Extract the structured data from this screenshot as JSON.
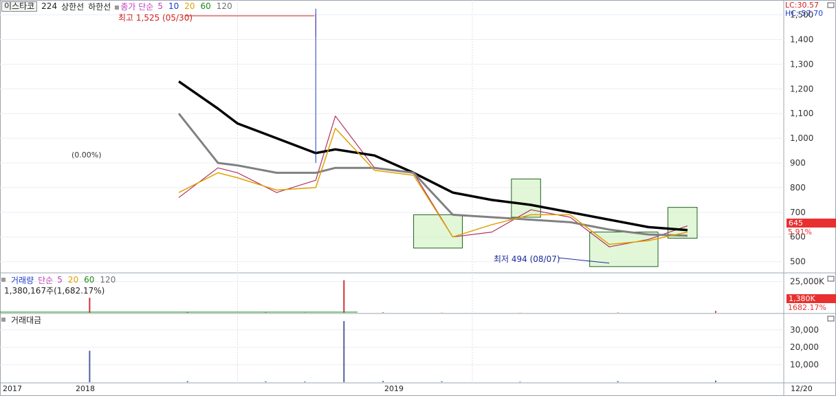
{
  "header": {
    "market": "이스타코",
    "ticker": "224",
    "upper_limit_label": "상한선",
    "lower_limit_label": "하한선",
    "price_type": "종가 단순",
    "ma_periods": [
      "5",
      "10",
      "20",
      "60",
      "120"
    ],
    "ma_colors": [
      "#c040c0",
      "#1a3ad0",
      "#e0a000",
      "#1a8a1a",
      "#707070"
    ]
  },
  "price_readouts": {
    "lc": "LC:30.57",
    "hc": "HC:-57.70",
    "last_price": "645",
    "last_change": "5.91%"
  },
  "annotations": {
    "high": "최고 1,525 (05/30)",
    "low": "최저 494 (08/07)",
    "ref": "(0.00%)"
  },
  "volume_panel": {
    "title": "거래량",
    "type": "단순",
    "periods": [
      "5",
      "20",
      "60",
      "120"
    ],
    "colors": [
      "#c040c0",
      "#e0a000",
      "#1a8a1a",
      "#707070"
    ],
    "current": "1,380,167주(1,682.17%)",
    "axis_tick": "25,000K",
    "last_value": "1,380K",
    "last_change": "1682.17%"
  },
  "amount_panel": {
    "title": "거래대금",
    "ticks": [
      "30,000",
      "20,000",
      "10,000"
    ]
  },
  "x_axis": {
    "labels": [
      "2017",
      "2018",
      "2019"
    ],
    "right_label": "12/20"
  },
  "chart_data": [
    {
      "type": "line",
      "title": "",
      "y_ticks": [
        500,
        600,
        700,
        800,
        900,
        1000,
        1100,
        1200,
        1300,
        1400,
        1500
      ],
      "ylim": [
        460,
        1510
      ],
      "x": [
        "2017-10",
        "2017-12",
        "2018-01",
        "2018-03",
        "2018-05",
        "2018-06",
        "2018-08",
        "2018-10",
        "2018-12",
        "2019-02",
        "2019-04",
        "2019-06",
        "2019-08",
        "2019-10",
        "2019-12"
      ],
      "series": [
        {
          "name": "",
          "role": "close",
          "color": "#b03060",
          "values": [
            760,
            880,
            860,
            780,
            830,
            1090,
            880,
            860,
            600,
            620,
            710,
            680,
            560,
            590,
            645
          ]
        },
        {
          "name": "120",
          "role": "ma120",
          "color": "#000000",
          "values": [
            1230,
            1120,
            1060,
            1000,
            940,
            955,
            930,
            860,
            780,
            750,
            730,
            700,
            670,
            640,
            628
          ]
        },
        {
          "name": "60",
          "role": "ma60",
          "color": "#808080",
          "values": [
            1100,
            900,
            890,
            860,
            860,
            880,
            880,
            860,
            690,
            680,
            670,
            660,
            630,
            610,
            605
          ]
        },
        {
          "name": "20",
          "role": "ma20",
          "color": "#e0a000",
          "values": [
            780,
            860,
            840,
            790,
            800,
            1040,
            870,
            850,
            600,
            650,
            690,
            690,
            570,
            585,
            620
          ]
        }
      ],
      "markers": {
        "high": {
          "x": "2018-05",
          "y": 1525
        },
        "low": {
          "x": "2019-08",
          "y": 494
        }
      },
      "boxes": [
        {
          "x0": "2018-10",
          "x1": "2018-12",
          "y0": 555,
          "y1": 690
        },
        {
          "x0": "2019-03",
          "x1": "2019-04",
          "y0": 680,
          "y1": 835
        },
        {
          "x0": "2019-07",
          "x1": "2019-10",
          "y0": 480,
          "y1": 620
        },
        {
          "x0": "2019-11",
          "x1": "2019-12",
          "y0": 595,
          "y1": 720
        }
      ]
    },
    {
      "type": "bar",
      "title": "",
      "y_ticks": [
        25000
      ],
      "ylim": [
        0,
        28000
      ],
      "values_k": [
        12000,
        300,
        200,
        100,
        26000,
        400,
        150,
        100,
        250,
        1380
      ]
    },
    {
      "type": "bar",
      "title": "",
      "y_ticks": [
        10000,
        20000,
        30000
      ],
      "ylim": [
        0,
        37000
      ],
      "values": [
        18000,
        600,
        500,
        400,
        35000,
        700,
        500,
        300,
        600,
        900
      ]
    }
  ]
}
